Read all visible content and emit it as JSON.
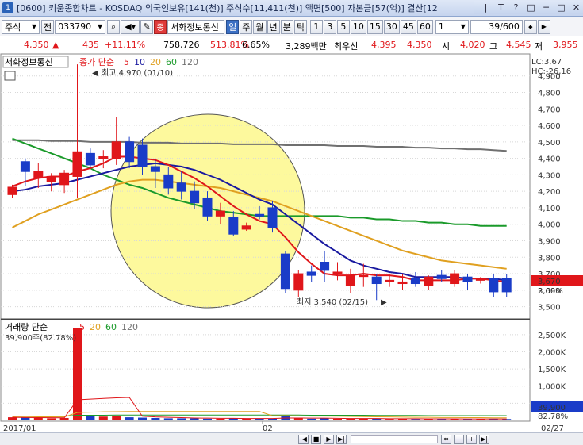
{
  "window": {
    "title": "[0600] 키움종합차트 - KOSDAQ 외국인보유[141(천)] 주식수[11,411(천)] 액면[500] 자본금[57(억)] 결산[12",
    "buttons": [
      "|",
      "T",
      "?",
      "□",
      "─",
      "□",
      "✕"
    ]
  },
  "toolbar": {
    "market": "주식",
    "market_btn": "전",
    "code": "033790",
    "stock_name": "서화정보통신",
    "periods": [
      "일",
      "주",
      "월",
      "년",
      "분",
      "틱"
    ],
    "active_period": "일",
    "minutes": [
      "1",
      "3",
      "5",
      "10",
      "15",
      "30",
      "45",
      "60"
    ],
    "count_select": "1",
    "range": "39/600",
    "red_icon": "종"
  },
  "infobar": {
    "price": "4,350",
    "change_arrow": "▲",
    "change": "435",
    "change_pct": "+11.11%",
    "volume": "758,726",
    "vol_ratio": "513.81%",
    "turnover": "6.65%",
    "amount": "3,289백만",
    "best_ask_label": "최우선",
    "best_ask": "4,395",
    "best_bid": "4,350",
    "open_label": "시",
    "open": "4,020",
    "high_label": "고",
    "high": "4,545",
    "low_label": "저",
    "low": "3,955"
  },
  "price_panel": {
    "stock_label": "서화정보통신",
    "legend_prefix": "종가 단순",
    "ma_periods": [
      "5",
      "10",
      "20",
      "60",
      "120"
    ],
    "ma_colors": [
      "#e0161a",
      "#1a1aa0",
      "#e0a020",
      "#1a9a2a",
      "#707070"
    ],
    "lc": "LC:3,67",
    "hc": "HC:-26,16",
    "max_label": "최고 4,970 (01/10)",
    "min_label": "최저 3,540 (02/15)",
    "current_tag": "3,670",
    "current_pct": "2.09%",
    "y_ticks": [
      "4,900",
      "4,800",
      "4,700",
      "4,600",
      "4,500",
      "4,400",
      "4,300",
      "4,200",
      "4,100",
      "4,000",
      "3,900",
      "3,800",
      "3,700",
      "3,600",
      "3,500"
    ]
  },
  "volume_panel": {
    "legend_prefix": "거래량 단순",
    "ma_periods": [
      "5",
      "20",
      "60",
      "120"
    ],
    "ma_colors": [
      "#e0161a",
      "#e0a020",
      "#1a9a2a",
      "#707070"
    ],
    "last_volume": "39,900주(82.78%)",
    "y_ticks": [
      "2,500K",
      "2,000K",
      "1,500K",
      "1,000K",
      "500,000"
    ],
    "current_tag": "39,900",
    "current_pct": "82.78%"
  },
  "x_axis": {
    "labels": [
      "2017/01",
      "02"
    ],
    "right_label": "02/27"
  },
  "chart_data": {
    "type": "candlestick",
    "candles": [
      {
        "o": 4180,
        "h": 4240,
        "l": 4160,
        "c": 4225
      },
      {
        "o": 4380,
        "h": 4400,
        "l": 4230,
        "c": 4320
      },
      {
        "o": 4280,
        "h": 4370,
        "l": 4220,
        "c": 4320
      },
      {
        "o": 4260,
        "h": 4310,
        "l": 4200,
        "c": 4290
      },
      {
        "o": 4240,
        "h": 4330,
        "l": 4190,
        "c": 4310
      },
      {
        "o": 4290,
        "h": 4970,
        "l": 4160,
        "c": 4440
      },
      {
        "o": 4430,
        "h": 4460,
        "l": 4350,
        "c": 4360
      },
      {
        "o": 4400,
        "h": 4450,
        "l": 4340,
        "c": 4410
      },
      {
        "o": 4400,
        "h": 4650,
        "l": 4360,
        "c": 4500
      },
      {
        "o": 4500,
        "h": 4530,
        "l": 4340,
        "c": 4380
      },
      {
        "o": 4480,
        "h": 4520,
        "l": 4300,
        "c": 4350
      },
      {
        "o": 4350,
        "h": 4390,
        "l": 4220,
        "c": 4320
      },
      {
        "o": 4300,
        "h": 4350,
        "l": 4180,
        "c": 4220
      },
      {
        "o": 4250,
        "h": 4320,
        "l": 4150,
        "c": 4200
      },
      {
        "o": 4200,
        "h": 4260,
        "l": 4090,
        "c": 4130
      },
      {
        "o": 4160,
        "h": 4200,
        "l": 4020,
        "c": 4050
      },
      {
        "o": 4050,
        "h": 4130,
        "l": 4000,
        "c": 4080
      },
      {
        "o": 4040,
        "h": 4080,
        "l": 3930,
        "c": 3940
      },
      {
        "o": 3970,
        "h": 4010,
        "l": 3960,
        "c": 3990
      },
      {
        "o": 4060,
        "h": 4110,
        "l": 4030,
        "c": 4050
      },
      {
        "o": 4100,
        "h": 4140,
        "l": 3950,
        "c": 3980
      },
      {
        "o": 3820,
        "h": 3840,
        "l": 3580,
        "c": 3610
      },
      {
        "o": 3600,
        "h": 3720,
        "l": 3560,
        "c": 3700
      },
      {
        "o": 3710,
        "h": 3750,
        "l": 3650,
        "c": 3690
      },
      {
        "o": 3770,
        "h": 3840,
        "l": 3650,
        "c": 3720
      },
      {
        "o": 3700,
        "h": 3770,
        "l": 3660,
        "c": 3710
      },
      {
        "o": 3630,
        "h": 3730,
        "l": 3580,
        "c": 3690
      },
      {
        "o": 3690,
        "h": 3760,
        "l": 3620,
        "c": 3690
      },
      {
        "o": 3680,
        "h": 3700,
        "l": 3540,
        "c": 3640
      },
      {
        "o": 3650,
        "h": 3700,
        "l": 3620,
        "c": 3660
      },
      {
        "o": 3640,
        "h": 3700,
        "l": 3600,
        "c": 3650
      },
      {
        "o": 3670,
        "h": 3710,
        "l": 3620,
        "c": 3640
      },
      {
        "o": 3630,
        "h": 3690,
        "l": 3600,
        "c": 3680
      },
      {
        "o": 3690,
        "h": 3720,
        "l": 3650,
        "c": 3670
      },
      {
        "o": 3640,
        "h": 3720,
        "l": 3620,
        "c": 3700
      },
      {
        "o": 3680,
        "h": 3700,
        "l": 3600,
        "c": 3650
      },
      {
        "o": 3660,
        "h": 3680,
        "l": 3640,
        "c": 3670
      },
      {
        "o": 3670,
        "h": 3700,
        "l": 3560,
        "c": 3590
      },
      {
        "o": 3670,
        "h": 3700,
        "l": 3560,
        "c": 3590
      }
    ],
    "ma5": [
      4230,
      4260,
      4280,
      4290,
      4290,
      4320,
      4340,
      4370,
      4410,
      4410,
      4400,
      4390,
      4360,
      4320,
      4280,
      4230,
      4170,
      4110,
      4060,
      4020,
      4000,
      3920,
      3830,
      3760,
      3700,
      3690,
      3690,
      3700,
      3690,
      3690,
      3680,
      3660,
      3660,
      3660,
      3660,
      3670,
      3670,
      3660,
      3650
    ],
    "ma10": [
      4200,
      4210,
      4230,
      4240,
      4250,
      4270,
      4290,
      4310,
      4330,
      4350,
      4360,
      4370,
      4360,
      4350,
      4330,
      4300,
      4270,
      4230,
      4190,
      4150,
      4120,
      4060,
      4000,
      3940,
      3880,
      3830,
      3780,
      3750,
      3730,
      3710,
      3700,
      3680,
      3680,
      3680,
      3680,
      3670,
      3670,
      3670,
      3660
    ],
    "ma20": [
      3980,
      4020,
      4060,
      4090,
      4120,
      4150,
      4180,
      4210,
      4240,
      4260,
      4270,
      4270,
      4260,
      4250,
      4240,
      4230,
      4220,
      4200,
      4180,
      4160,
      4140,
      4110,
      4080,
      4050,
      4020,
      3990,
      3960,
      3930,
      3900,
      3870,
      3840,
      3820,
      3800,
      3780,
      3770,
      3760,
      3750,
      3740,
      3730
    ],
    "ma60": [
      4520,
      4490,
      4460,
      4430,
      4400,
      4370,
      4340,
      4300,
      4270,
      4240,
      4220,
      4190,
      4160,
      4140,
      4120,
      4100,
      4080,
      4070,
      4060,
      4050,
      4050,
      4050,
      4050,
      4050,
      4050,
      4050,
      4040,
      4040,
      4030,
      4030,
      4020,
      4020,
      4010,
      4010,
      4000,
      4000,
      3990,
      3990,
      3990
    ],
    "ma120": [
      4510,
      4510,
      4510,
      4505,
      4505,
      4505,
      4500,
      4500,
      4500,
      4500,
      4495,
      4495,
      4495,
      4490,
      4490,
      4490,
      4490,
      4485,
      4485,
      4485,
      4485,
      4480,
      4480,
      4480,
      4480,
      4475,
      4475,
      4475,
      4470,
      4470,
      4470,
      4465,
      4465,
      4460,
      4460,
      4455,
      4455,
      4450,
      4445
    ],
    "volume": [
      90,
      80,
      70,
      60,
      70,
      2700,
      130,
      110,
      140,
      90,
      80,
      70,
      60,
      60,
      60,
      50,
      50,
      60,
      50,
      60,
      50,
      120,
      60,
      50,
      60,
      50,
      50,
      50,
      60,
      40,
      50,
      40,
      40,
      50,
      40,
      40,
      40,
      50,
      40
    ],
    "vol_ma5": [
      90,
      85,
      80,
      78,
      74,
      600,
      620,
      640,
      660,
      670,
      120,
      100,
      90,
      80,
      70,
      65,
      60,
      60,
      55,
      55,
      55,
      70,
      70,
      65,
      65,
      60,
      55,
      55,
      55,
      50,
      50,
      48,
      45,
      45,
      45,
      43,
      42,
      43,
      42
    ],
    "vol_ma20": [
      110,
      110,
      105,
      105,
      100,
      230,
      240,
      250,
      255,
      260,
      260,
      260,
      260,
      260,
      260,
      260,
      260,
      260,
      260,
      260,
      135,
      140,
      130,
      125,
      125,
      120,
      115,
      110,
      105,
      100,
      95,
      90,
      90,
      85,
      85,
      80,
      80,
      75,
      75
    ],
    "vol_ma60": [
      120,
      120,
      120,
      120,
      120,
      150,
      150,
      150,
      155,
      155,
      155,
      155,
      155,
      155,
      155,
      155,
      155,
      155,
      155,
      155,
      155,
      155,
      155,
      150,
      150,
      150,
      150,
      150,
      145,
      145,
      145,
      145,
      140,
      140,
      140,
      140,
      140,
      140,
      140
    ],
    "y_range": [
      3450,
      4990
    ],
    "vol_range": [
      0,
      2750
    ]
  }
}
